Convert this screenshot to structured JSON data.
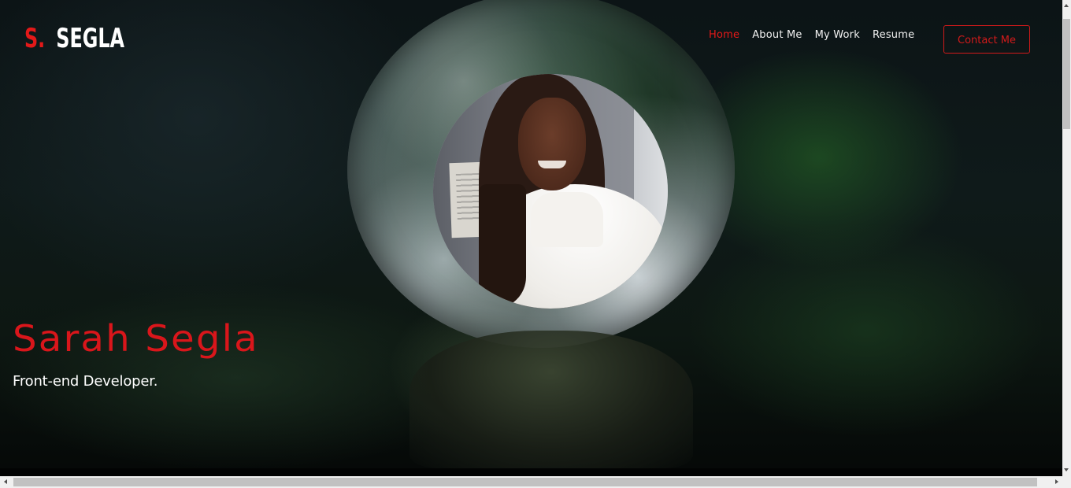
{
  "header": {
    "logo_initial": "S.",
    "logo_surname": "SEGLA",
    "colors": {
      "accent": "#e31919",
      "text": "#ffffff"
    }
  },
  "nav": {
    "items": [
      {
        "label": "Home",
        "active": true
      },
      {
        "label": "About Me",
        "active": false
      },
      {
        "label": "My Work",
        "active": false
      },
      {
        "label": "Resume",
        "active": false
      }
    ],
    "contact_label": "Contact Me"
  },
  "hero": {
    "name": "Sarah Segla",
    "role": "Front-end Developer.",
    "avatar": "profile-photo",
    "background": "glass-sphere-on-moss-photo"
  },
  "scrollbars": {
    "vertical": "scrollbar-vertical",
    "horizontal": "scrollbar-horizontal"
  }
}
